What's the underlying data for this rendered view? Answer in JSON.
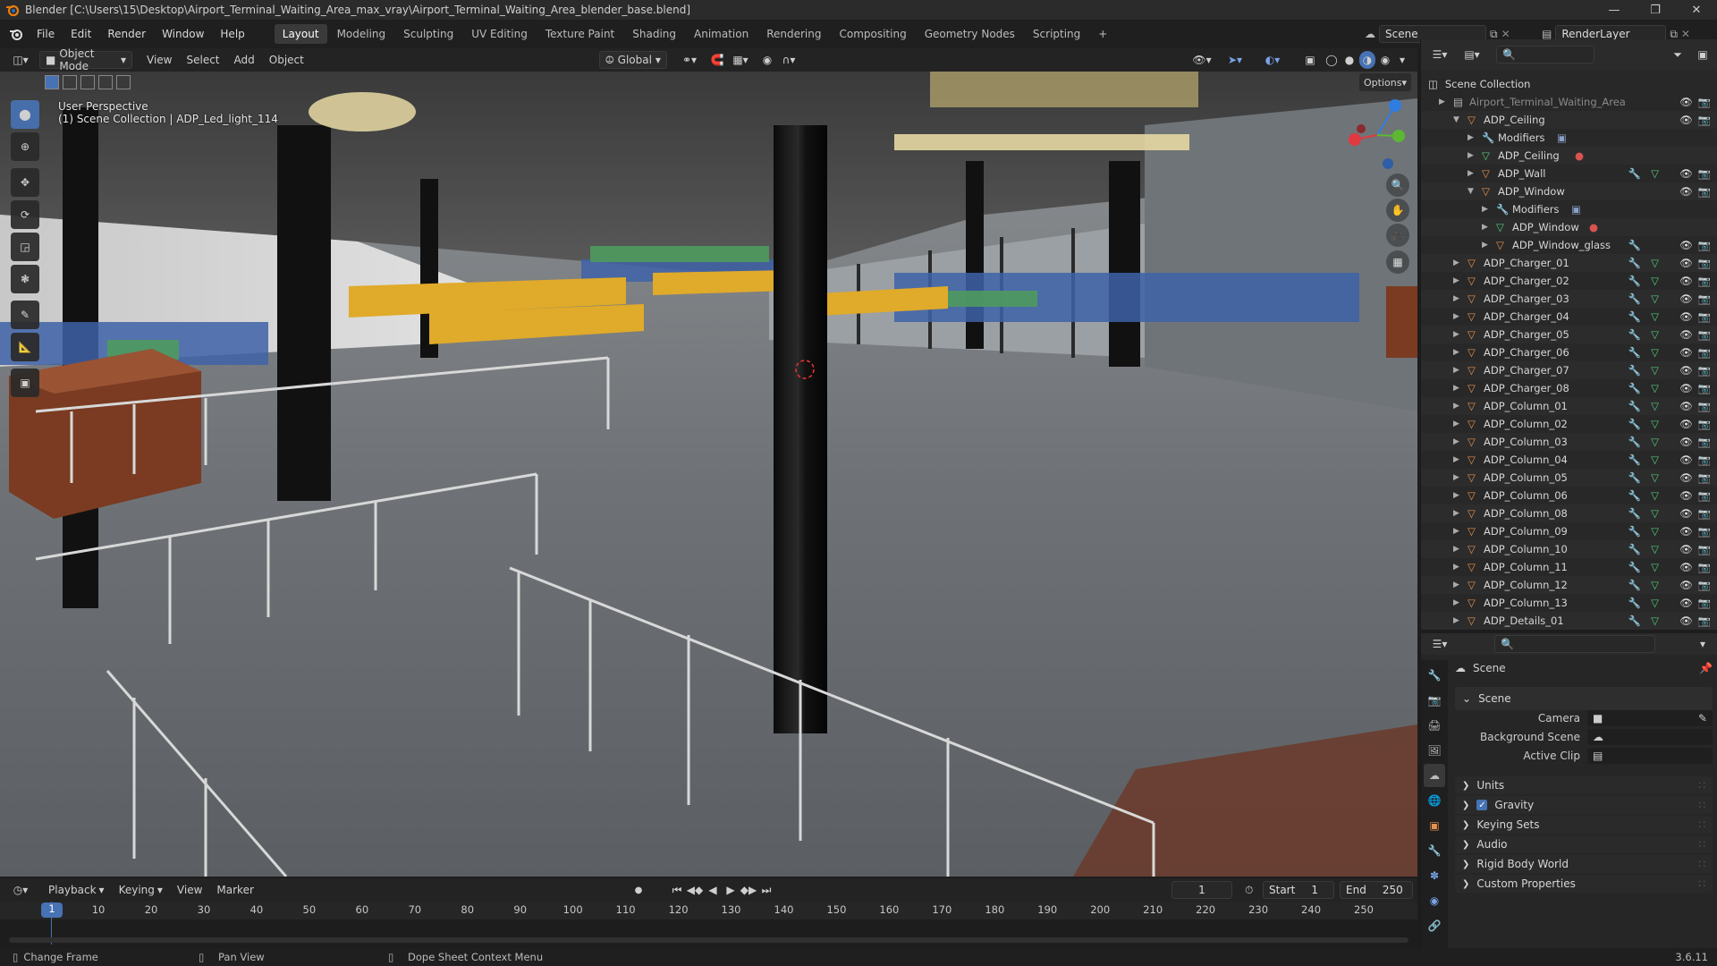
{
  "title": "Blender [C:\\Users\\15\\Desktop\\Airport_Terminal_Waiting_Area_max_vray\\Airport_Terminal_Waiting_Area_blender_base.blend]",
  "menu": [
    "File",
    "Edit",
    "Render",
    "Window",
    "Help"
  ],
  "workspaces": [
    "Layout",
    "Modeling",
    "Sculpting",
    "UV Editing",
    "Texture Paint",
    "Shading",
    "Animation",
    "Rendering",
    "Compositing",
    "Geometry Nodes",
    "Scripting",
    "+"
  ],
  "scene_name": "Scene",
  "view_layer": "RenderLayer",
  "viewport": {
    "mode": "Object Mode",
    "menus": [
      "View",
      "Select",
      "Add",
      "Object"
    ],
    "orientation": "Global",
    "options": "Options",
    "info_line1": "User Perspective",
    "info_line2": "(1) Scene Collection | ADP_Led_light_114"
  },
  "icons": {
    "blender": "blender-logo-icon",
    "select": "select-box-icon",
    "cursor": "cursor-icon",
    "move": "move-icon",
    "rotate": "rotate-icon",
    "scale": "scale-icon",
    "transform": "transform-icon",
    "annotate": "annotate-icon",
    "measure": "measure-icon",
    "add_cube": "add-cube-icon"
  },
  "outliner": {
    "root": "Scene Collection",
    "rows": [
      {
        "label": "Airport_Terminal_Waiting_Area",
        "depth": 1,
        "kind": "collection",
        "dim": true
      },
      {
        "label": "ADP_Ceiling",
        "depth": 2,
        "kind": "object",
        "open": true
      },
      {
        "label": "Modifiers",
        "depth": 3,
        "kind": "modifier"
      },
      {
        "label": "ADP_Ceiling",
        "depth": 3,
        "kind": "mesh"
      },
      {
        "label": "ADP_Wall",
        "depth": 3,
        "kind": "object"
      },
      {
        "label": "ADP_Window",
        "depth": 3,
        "kind": "object",
        "open": true
      },
      {
        "label": "Modifiers",
        "depth": 4,
        "kind": "modifier"
      },
      {
        "label": "ADP_Window",
        "depth": 4,
        "kind": "mesh"
      },
      {
        "label": "ADP_Window_glass",
        "depth": 4,
        "kind": "object"
      },
      {
        "label": "ADP_Charger_01",
        "depth": 2,
        "kind": "object"
      },
      {
        "label": "ADP_Charger_02",
        "depth": 2,
        "kind": "object"
      },
      {
        "label": "ADP_Charger_03",
        "depth": 2,
        "kind": "object"
      },
      {
        "label": "ADP_Charger_04",
        "depth": 2,
        "kind": "object"
      },
      {
        "label": "ADP_Charger_05",
        "depth": 2,
        "kind": "object"
      },
      {
        "label": "ADP_Charger_06",
        "depth": 2,
        "kind": "object"
      },
      {
        "label": "ADP_Charger_07",
        "depth": 2,
        "kind": "object"
      },
      {
        "label": "ADP_Charger_08",
        "depth": 2,
        "kind": "object"
      },
      {
        "label": "ADP_Column_01",
        "depth": 2,
        "kind": "object"
      },
      {
        "label": "ADP_Column_02",
        "depth": 2,
        "kind": "object"
      },
      {
        "label": "ADP_Column_03",
        "depth": 2,
        "kind": "object"
      },
      {
        "label": "ADP_Column_04",
        "depth": 2,
        "kind": "object"
      },
      {
        "label": "ADP_Column_05",
        "depth": 2,
        "kind": "object"
      },
      {
        "label": "ADP_Column_06",
        "depth": 2,
        "kind": "object"
      },
      {
        "label": "ADP_Column_08",
        "depth": 2,
        "kind": "object"
      },
      {
        "label": "ADP_Column_09",
        "depth": 2,
        "kind": "object"
      },
      {
        "label": "ADP_Column_10",
        "depth": 2,
        "kind": "object"
      },
      {
        "label": "ADP_Column_11",
        "depth": 2,
        "kind": "object"
      },
      {
        "label": "ADP_Column_12",
        "depth": 2,
        "kind": "object"
      },
      {
        "label": "ADP_Column_13",
        "depth": 2,
        "kind": "object"
      },
      {
        "label": "ADP_Details_01",
        "depth": 2,
        "kind": "object"
      }
    ]
  },
  "properties": {
    "header": "Scene",
    "section": "Scene",
    "fields": [
      {
        "label": "Camera"
      },
      {
        "label": "Background Scene"
      },
      {
        "label": "Active Clip"
      }
    ],
    "panels": [
      "Units",
      "Gravity",
      "Keying Sets",
      "Audio",
      "Rigid Body World",
      "Custom Properties"
    ]
  },
  "timeline": {
    "menus": [
      "Playback",
      "Keying",
      "View",
      "Marker"
    ],
    "current_frame": "1",
    "start_label": "Start",
    "start": "1",
    "end_label": "End",
    "end": "250",
    "ticks": [
      "1",
      "10",
      "20",
      "30",
      "40",
      "50",
      "60",
      "70",
      "80",
      "90",
      "100",
      "110",
      "120",
      "130",
      "140",
      "150",
      "160",
      "170",
      "180",
      "190",
      "200",
      "210",
      "220",
      "230",
      "240",
      "250"
    ]
  },
  "status": {
    "left": "Change Frame",
    "mid": "Pan View",
    "right": "Dope Sheet Context Menu",
    "version": "3.6.11"
  },
  "colors": {
    "accent": "#4772b3",
    "object": "#e6914c",
    "mesh": "#52c97a",
    "modifier": "#7aa3e8",
    "orange": "#e87d0d"
  }
}
